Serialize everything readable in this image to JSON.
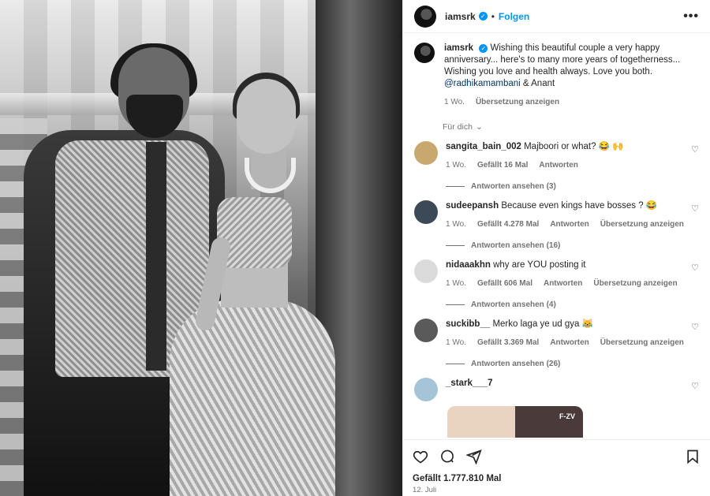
{
  "header": {
    "username": "iamsrk",
    "verified_mark": "✓",
    "follow_label": "Folgen",
    "more_label": "•••"
  },
  "caption": {
    "username": "iamsrk",
    "text": "Wishing this beautiful couple a very happy anniversary... here's to many more years of togetherness... Wishing you love and health always. Love you both.",
    "mention": "@radhikamambani",
    "tail": "& Anant",
    "time": "1 Wo.",
    "translate": "Übersetzung anzeigen"
  },
  "filter": {
    "label": "Für dich"
  },
  "comments": [
    {
      "username": "sangita_bain_002",
      "text": "Majboori or what? 😂 🙌",
      "time": "1 Wo.",
      "likes": "Gefällt 16 Mal",
      "reply": "Antworten",
      "translate": "",
      "replies": "Antworten ansehen (3)",
      "avatar_color": "#c9a870"
    },
    {
      "username": "sudeepansh",
      "text": "Because even kings have bosses ? 😂",
      "time": "1 Wo.",
      "likes": "Gefällt 4.278 Mal",
      "reply": "Antworten",
      "translate": "Übersetzung anzeigen",
      "replies": "Antworten ansehen (16)",
      "avatar_color": "#3b4a56"
    },
    {
      "username": "nidaaakhn",
      "text": "why are YOU posting it",
      "time": "1 Wo.",
      "likes": "Gefällt 606 Mal",
      "reply": "Antworten",
      "translate": "Übersetzung anzeigen",
      "replies": "Antworten ansehen (4)",
      "avatar_color": "#dbdbdb"
    },
    {
      "username": "suckibb__",
      "text": "Merko laga ye ud gya 😹",
      "time": "1 Wo.",
      "likes": "Gefällt 3.369 Mal",
      "reply": "Antworten",
      "translate": "Übersetzung anzeigen",
      "replies": "Antworten ansehen (26)",
      "avatar_color": "#5a5a5a"
    },
    {
      "username": "_stark___7",
      "text": "",
      "avatar_color": "#a6c4d8"
    }
  ],
  "preview_tag": "F-ZV",
  "footer": {
    "likes": "Gefällt 1.777.810 Mal",
    "date": "12. Juli"
  },
  "colors": {
    "accent": "#0095f6",
    "muted": "#737373",
    "mention": "#00376b"
  }
}
